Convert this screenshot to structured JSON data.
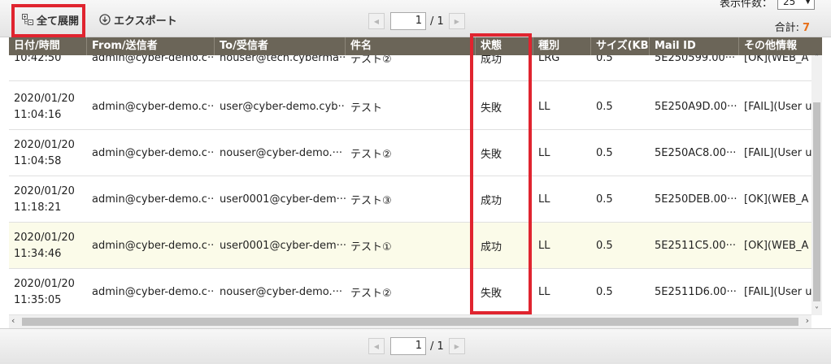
{
  "toolbar": {
    "expand_all_label": "全て展開",
    "export_label": "エクスポート",
    "display_count_label": "表示件数：",
    "display_count_value": "25",
    "total_label": "合計:",
    "total_value": "7"
  },
  "pager_top": {
    "page_value": "1",
    "total_pages": "/ 1"
  },
  "pager_bottom": {
    "page_value": "1",
    "total_pages": "/ 1"
  },
  "table": {
    "headers": [
      "日付/時間",
      "From/送信者",
      "To/受信者",
      "件名",
      "状態",
      "種別",
      "サイズ(KB)",
      "Mail ID",
      "その他情報"
    ],
    "rows": [
      {
        "date": "",
        "time": "10:42:50",
        "from": "admin@cyber-demo.c···",
        "to": "nouser@tech.cyberma···",
        "subject": "テスト②",
        "status": "成功",
        "type": "LRG",
        "size": "0.5",
        "mail_id": "5E250599.00···",
        "info": "[OK](WEB_A"
      },
      {
        "date": "2020/01/20",
        "time": "11:04:16",
        "from": "admin@cyber-demo.c···",
        "to": "user@cyber-demo.cyb···",
        "subject": "テスト",
        "status": "失敗",
        "type": "LL",
        "size": "0.5",
        "mail_id": "5E250A9D.00···",
        "info": "[FAIL](User u"
      },
      {
        "date": "2020/01/20",
        "time": "11:04:58",
        "from": "admin@cyber-demo.c···",
        "to": "nouser@cyber-demo.···",
        "subject": "テスト②",
        "status": "失敗",
        "type": "LL",
        "size": "0.5",
        "mail_id": "5E250AC8.00···",
        "info": "[FAIL](User u"
      },
      {
        "date": "2020/01/20",
        "time": "11:18:21",
        "from": "admin@cyber-demo.c···",
        "to": "user0001@cyber-dem···",
        "subject": "テスト③",
        "status": "成功",
        "type": "LL",
        "size": "0.5",
        "mail_id": "5E250DEB.00···",
        "info": "[OK](WEB_A"
      },
      {
        "date": "2020/01/20",
        "time": "11:34:46",
        "from": "admin@cyber-demo.c···",
        "to": "user0001@cyber-dem···",
        "subject": "テスト①",
        "status": "成功",
        "type": "LL",
        "size": "0.5",
        "mail_id": "5E2511C5.00···",
        "info": "[OK](WEB_A"
      },
      {
        "date": "2020/01/20",
        "time": "11:35:05",
        "from": "admin@cyber-demo.c···",
        "to": "nouser@cyber-demo.···",
        "subject": "テスト②",
        "status": "失敗",
        "type": "LL",
        "size": "0.5",
        "mail_id": "5E2511D6.00···",
        "info": "[FAIL](User u"
      }
    ]
  },
  "colors": {
    "header_bg": "#6b6558",
    "highlight_red": "#e0242f",
    "total_orange": "#e8701a",
    "selected_row_bg": "#fbfbe9"
  },
  "icons": {
    "expand": "expand-tree-icon",
    "export": "download-circle-icon"
  }
}
